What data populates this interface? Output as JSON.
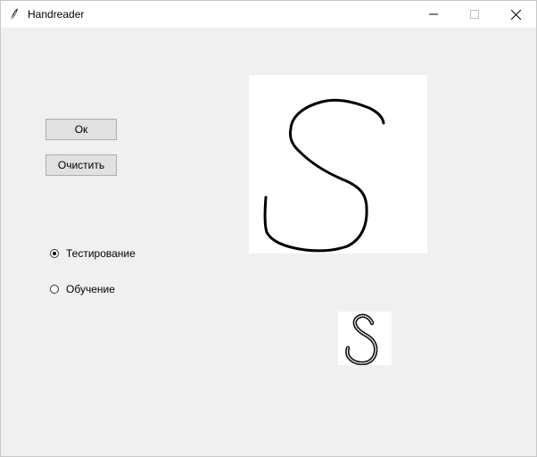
{
  "window": {
    "title": "Handreader",
    "icon": "feather-icon",
    "controls": [
      "minimize-icon",
      "maximize-icon",
      "close-icon"
    ]
  },
  "buttons": {
    "ok_label": "Ок",
    "clear_label": "Очистить"
  },
  "mode": {
    "options": [
      {
        "label": "Тестирование",
        "selected": true
      },
      {
        "label": "Обучение",
        "selected": false
      }
    ]
  },
  "canvases": {
    "drawing": {
      "content": "handwritten letter S"
    },
    "preview": {
      "content": "downscaled letter S"
    }
  }
}
